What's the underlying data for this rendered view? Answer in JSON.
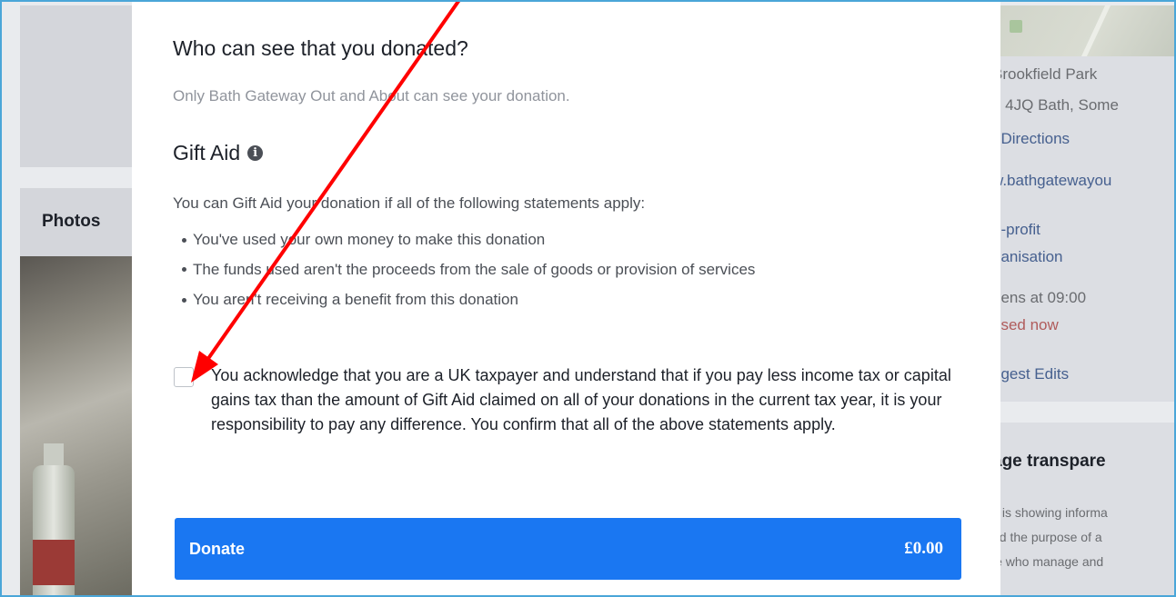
{
  "background": {
    "photos_label": "Photos",
    "info_lines": [
      {
        "text": "Brookfield Park",
        "style": "text"
      },
      {
        "text": "​1 4JQ Bath, Some",
        "style": "text"
      },
      {
        "text": "t Directions",
        "style": "link"
      },
      {
        "text": "w.bathgatewayou",
        "style": "link"
      },
      {
        "text": "n-profit",
        "style": "link"
      },
      {
        "text": "ganisation",
        "style": "link"
      },
      {
        "text": "pens at 09:00",
        "style": "text"
      },
      {
        "text": "osed now",
        "style": "red"
      },
      {
        "text": "ggest Edits",
        "style": "link"
      }
    ],
    "transparency_title": "age transpare",
    "transparency_lines": [
      "k is showing informa",
      "nd the purpose of a",
      "le who manage and"
    ]
  },
  "modal": {
    "visibility_heading": "Who can see that you donated?",
    "visibility_text": "Only Bath Gateway Out and About can see your donation.",
    "gift_aid_heading": "Gift Aid",
    "gift_aid_info_icon": "info-icon",
    "intro": "You can Gift Aid your donation if all of the following statements apply:",
    "bullets": [
      "You've used your own money to make this donation",
      "The funds used aren't the proceeds from the sale of goods or provision of services",
      "You aren't receiving a benefit from this donation"
    ],
    "acknowledgement": "You acknowledge that you are a UK taxpayer and understand that if you pay less income tax or capital gains tax than the amount of Gift Aid claimed on all of your donations in the current tax year, it is your responsibility to pay any difference. You confirm that all of the above statements apply.",
    "checkbox_checked": false,
    "donate_label": "Donate",
    "donate_amount": "£0.00"
  },
  "colors": {
    "donate_button": "#1a77f2",
    "annotation_arrow": "#ff0000",
    "frame": "#4aa6d8"
  }
}
